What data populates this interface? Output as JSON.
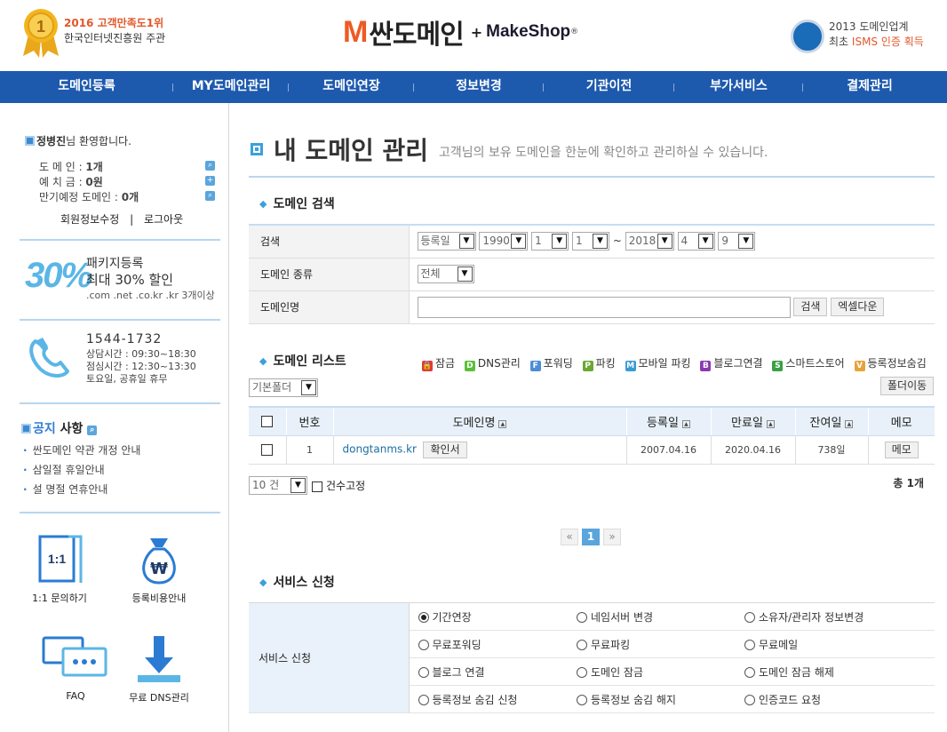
{
  "header": {
    "award_year_title": "2016 고객만족도1위",
    "award_sub": "한국인터넷진흥원 주관",
    "award_badge": "1",
    "logo_mark": "M",
    "logo_name": "싼도메인",
    "logo_plus": "+",
    "logo_partner": "MakeShop",
    "logo_partner_mark": "®",
    "isms_line1": "2013 도메인업계",
    "isms_line2_prefix": "최초 ",
    "isms_line2_highlight": "ISMS 인증 획득"
  },
  "nav": {
    "items": [
      {
        "label": "도메인등록"
      },
      {
        "label": "MY도메인관리"
      },
      {
        "label": "도메인연장"
      },
      {
        "label": "정보변경"
      },
      {
        "label": "기관이전"
      },
      {
        "label": "부가서비스"
      },
      {
        "label": "결제관리"
      }
    ]
  },
  "sidebar": {
    "user_name": "정병진",
    "welcome_suffix": "님 환영합니다.",
    "account": [
      {
        "label": "도 메 인 : ",
        "value": "1개"
      },
      {
        "label": "예 치 금 : ",
        "value": "0원"
      },
      {
        "label": "만기예정 도메인 : ",
        "value": "0개"
      }
    ],
    "edit_info": "회원정보수정",
    "divider": "|",
    "logout": "로그아웃",
    "promo_percent": "30%",
    "promo_line1": "패키지등록",
    "promo_line2": "최대 30% 할인",
    "promo_line3": ".com .net .co.kr .kr 3개이상",
    "phone": "1544-1732",
    "hours1": "상담시간 : 09:30~18:30",
    "hours2": "점심시간 : 12:30~13:30",
    "hours3": "토요일, 공휴일 휴무",
    "notice_title_a": "공지",
    "notice_title_b": "사항",
    "notices": [
      "싼도메인 약관 개정 안내",
      "삼일절 휴일안내",
      "설 명절 연휴안내"
    ],
    "quick_links": [
      {
        "label": "1:1 문의하기",
        "icon_text": "1:1"
      },
      {
        "label": "등록비용안내",
        "icon_text": "₩"
      },
      {
        "label": "FAQ"
      },
      {
        "label": "무료 DNS관리"
      }
    ]
  },
  "main": {
    "title": "내 도메인 관리",
    "desc": "고객님의 보유 도메인을 한눈에 확인하고 관리하실 수 있습니다.",
    "search": {
      "heading": "도메인 검색",
      "row1_label": "검색",
      "date_type": "등록일",
      "from_year": "1990",
      "from_month": "1",
      "from_day": "1",
      "tilde": "~",
      "to_year": "2018",
      "to_month": "4",
      "to_day": "9",
      "row2_label": "도메인 종류",
      "kind": "전체",
      "row3_label": "도메인명",
      "domain_value": "",
      "search_btn": "검색",
      "excel_btn": "엑셀다운"
    },
    "list": {
      "heading": "도메인 리스트",
      "legend": [
        {
          "mark": "🔒",
          "label": "잠금",
          "color": "#e03a3a"
        },
        {
          "mark": "D",
          "label": "DNS관리",
          "color": "#5bbf3a"
        },
        {
          "mark": "F",
          "label": "포워딩",
          "color": "#4b8ed6"
        },
        {
          "mark": "P",
          "label": "파킹",
          "color": "#6aa832"
        },
        {
          "mark": "M",
          "label": "모바일 파킹",
          "color": "#3a9ad6"
        },
        {
          "mark": "B",
          "label": "블로그연결",
          "color": "#8a3ab0"
        },
        {
          "mark": "S",
          "label": "스마트스토어",
          "color": "#3aa043"
        },
        {
          "mark": "V",
          "label": "등록정보숨김",
          "color": "#e8a23a"
        }
      ],
      "folder_select": "기본폴더",
      "folder_move_btn": "폴더이동",
      "columns": [
        "번호",
        "도메인명",
        "등록일",
        "만료일",
        "잔여일",
        "메모"
      ],
      "rows": [
        {
          "no": "1",
          "domain": "dongtanms.kr",
          "cert_btn": "확인서",
          "reg": "2007.04.16",
          "exp": "2020.04.16",
          "remain": "738일",
          "memo_btn": "메모"
        }
      ],
      "page_size": "10 건",
      "fix_count": "건수고정",
      "total": "총 1개",
      "pager": [
        "«",
        "1",
        "»"
      ]
    },
    "service": {
      "heading": "서비스 신청",
      "label": "서비스 신청",
      "options": [
        [
          "기간연장",
          "네임서버 변경",
          "소유자/관리자 정보변경"
        ],
        [
          "무료포워딩",
          "무료파킹",
          "무료메일"
        ],
        [
          "블로그 연결",
          "도메인 잠금",
          "도메인 잠금 해제"
        ],
        [
          "등록정보 숨김 신청",
          "등록정보 숨김 해지",
          "인증코드 요청"
        ]
      ],
      "selected": "기간연장"
    }
  }
}
